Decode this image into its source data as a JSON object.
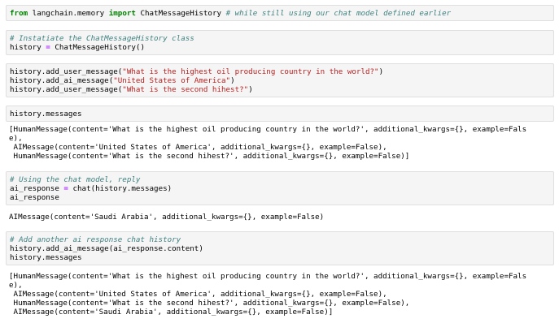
{
  "cells": [
    {
      "import_line": {
        "kw_from": "from",
        "module": " langchain.memory ",
        "kw_import": "import",
        "name": " ChatMessageHistory ",
        "comment": "# while still using our chat model defined earlier"
      }
    },
    {
      "comment": "# Instatiate the ChatMessageHistory class",
      "lhs": "history ",
      "op": "=",
      "rhs": " ChatMessageHistory()"
    },
    {
      "lines": [
        {
          "pre": "history.add_user_message(",
          "str": "\"What is the highest oil producing country in the world?\"",
          "post": ")"
        },
        {
          "pre": "history.add_ai_message(",
          "str": "\"United States of America\"",
          "post": ")"
        },
        {
          "pre": "history.add_user_message(",
          "str": "\"What is the second hihest?\"",
          "post": ")"
        }
      ]
    },
    {
      "code": "history.messages",
      "output": [
        "[HumanMessage(content='What is the highest oil producing country in the world?', additional_kwargs={}, example=Fals",
        "e),",
        " AIMessage(content='United States of America', additional_kwargs={}, example=False),",
        " HumanMessage(content='What is the second hihest?', additional_kwargs={}, example=False)]"
      ]
    },
    {
      "comment": "# Using the chat model, reply",
      "lhs": "ai_response ",
      "op": "=",
      "rhs": " chat(history.messages)",
      "last": "ai_response",
      "output": [
        "AIMessage(content='Saudi Arabia', additional_kwargs={}, example=False)"
      ]
    },
    {
      "comment": "# Add another ai response chat history",
      "line2": "history.add_ai_message(ai_response.content)",
      "line3": "history.messages",
      "output": [
        "[HumanMessage(content='What is the highest oil producing country in the world?', additional_kwargs={}, example=Fals",
        "e),",
        " AIMessage(content='United States of America', additional_kwargs={}, example=False),",
        " HumanMessage(content='What is the second hihest?', additional_kwargs={}, example=False),",
        " AIMessage(content='Saudi Arabia', additional_kwargs={}, example=False)]"
      ]
    }
  ]
}
